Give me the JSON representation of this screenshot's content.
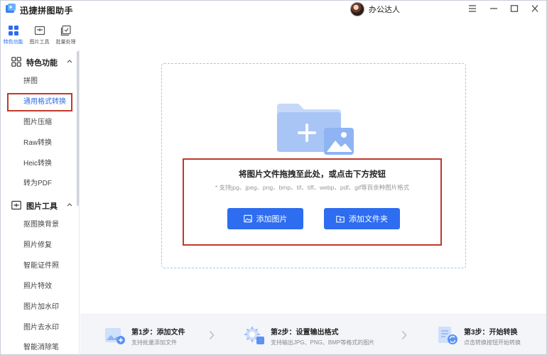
{
  "app": {
    "title": "迅捷拼图助手"
  },
  "user": {
    "name": "办公达人"
  },
  "tool_tabs": [
    {
      "label": "特色功能",
      "icon": "grid-icon",
      "active": true
    },
    {
      "label": "图片工具",
      "icon": "image-tool-icon",
      "active": false
    },
    {
      "label": "批量处理",
      "icon": "batch-icon",
      "active": false
    }
  ],
  "sidebar": {
    "sections": [
      {
        "label": "特色功能",
        "icon": "grid-icon",
        "items": [
          {
            "label": "拼图",
            "active": false
          },
          {
            "label": "通用格式转换",
            "active": true
          },
          {
            "label": "图片压缩",
            "active": false
          },
          {
            "label": "Raw转换",
            "active": false
          },
          {
            "label": "Heic转换",
            "active": false
          },
          {
            "label": "转为PDF",
            "active": false
          }
        ]
      },
      {
        "label": "图片工具",
        "icon": "image-tool-icon",
        "items": [
          {
            "label": "抠图换背景",
            "active": false
          },
          {
            "label": "照片修复",
            "active": false
          },
          {
            "label": "智能证件照",
            "active": false
          },
          {
            "label": "照片特效",
            "active": false
          },
          {
            "label": "图片加水印",
            "active": false
          },
          {
            "label": "图片去水印",
            "active": false
          },
          {
            "label": "智能消除笔",
            "active": false
          }
        ]
      }
    ]
  },
  "main": {
    "drop_title": "将图片文件拖拽至此处，或点击下方按钮",
    "drop_subtitle": "* 支持jpg、jpeg、png、bmp、tif、tiff、webp、pdf、gif等百余种图片格式",
    "add_image_label": "添加图片",
    "add_folder_label": "添加文件夹"
  },
  "steps": [
    {
      "title": "第1步：添加文件",
      "desc": "支持批量添加文件"
    },
    {
      "title": "第2步：设置输出格式",
      "desc": "支持输出JPG、PNG、BMP等格式的图片"
    },
    {
      "title": "第3步：开始转换",
      "desc": "点击转换按钮开始转换"
    }
  ],
  "colors": {
    "accent": "#2e6cf0",
    "highlight": "#c0392b"
  }
}
